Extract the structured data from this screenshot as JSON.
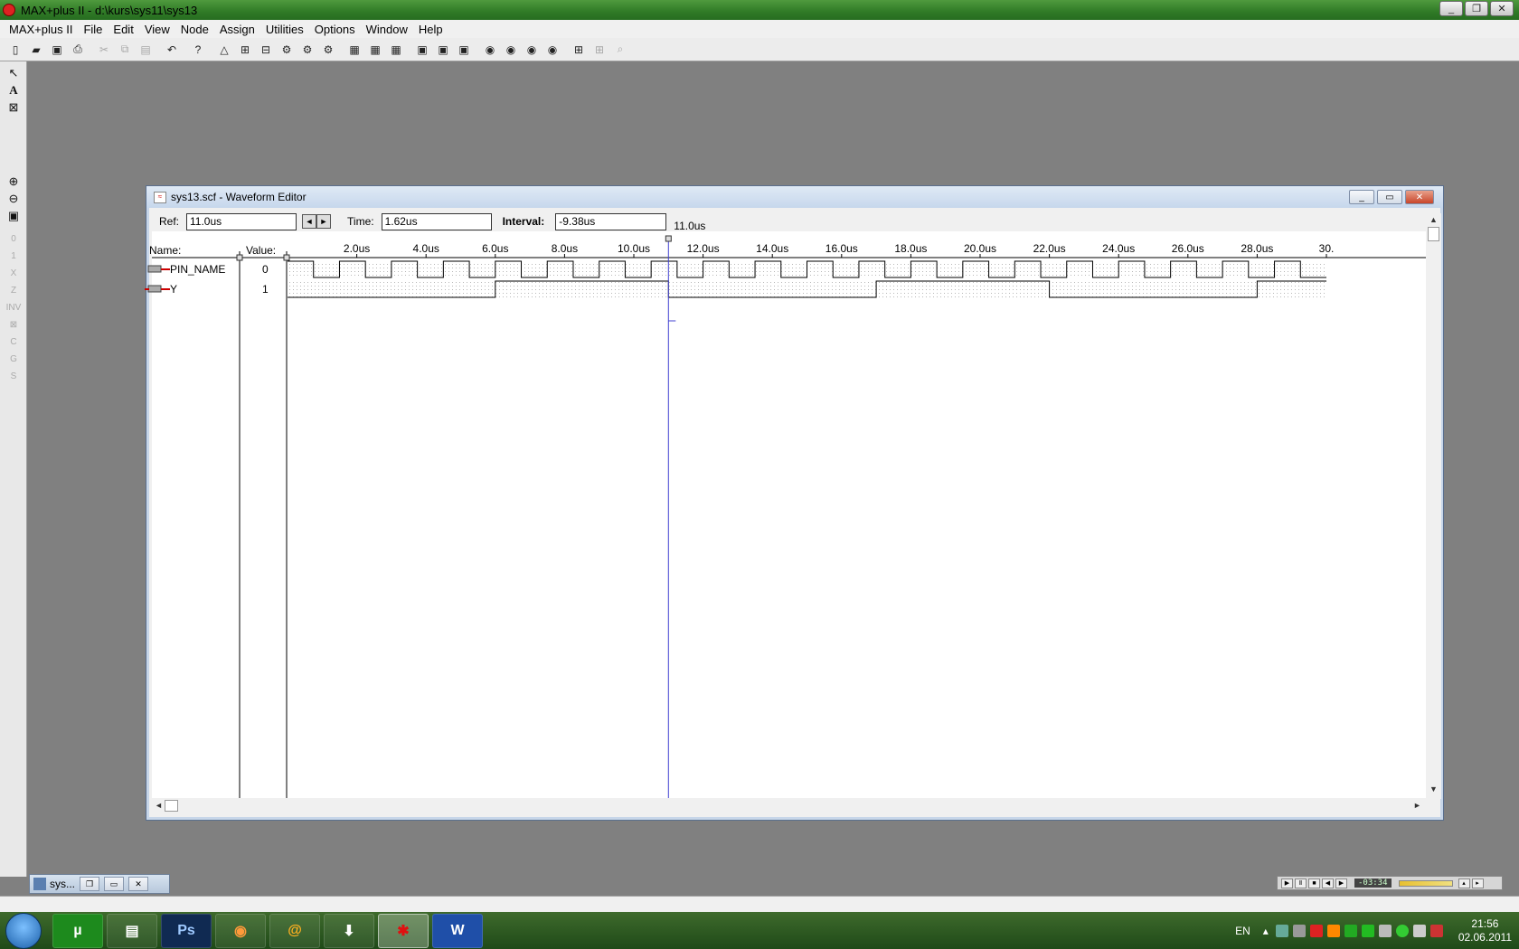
{
  "app": {
    "title": "MAX+plus II - d:\\kurs\\sys11\\sys13"
  },
  "menu": [
    "MAX+plus II",
    "File",
    "Edit",
    "View",
    "Node",
    "Assign",
    "Utilities",
    "Options",
    "Window",
    "Help"
  ],
  "waveform_window": {
    "title": "sys13.scf - Waveform Editor",
    "ref_label": "Ref:",
    "ref_value": "11.0us",
    "time_label": "Time:",
    "time_value": "1.62us",
    "interval_label": "Interval:",
    "interval_value": "-9.38us",
    "cursor_label": "11.0us",
    "cursor_time_us": 11.0,
    "name_header": "Name:",
    "value_header": "Value:",
    "time_axis": {
      "ticks": [
        "2.0us",
        "4.0us",
        "6.0us",
        "8.0us",
        "10.0us",
        "12.0us",
        "14.0us",
        "16.0us",
        "18.0us",
        "20.0us",
        "22.0us",
        "24.0us",
        "26.0us",
        "28.0us",
        "30."
      ],
      "range_us": [
        0,
        30
      ]
    },
    "signals": [
      {
        "name": "PIN_NAME",
        "value": "0",
        "type": "input",
        "waveform": "clock",
        "period_us": 1.5
      },
      {
        "name": "Y",
        "value": "1",
        "type": "output",
        "waveform": "levels",
        "transitions_us": [
          0,
          6.0,
          11.0,
          17.0,
          22.0,
          28.0
        ],
        "levels": [
          0,
          1,
          0,
          1,
          0,
          1
        ]
      }
    ]
  },
  "minimized_window": {
    "label": "sys..."
  },
  "taskbar": {
    "language": "EN",
    "time": "21:56",
    "date": "02.06.2011",
    "apps": [
      "utorrent",
      "explorer",
      "Ps",
      "firefox",
      "mail-agent",
      "downloader",
      "maxplus",
      "word"
    ]
  },
  "media_player": {
    "time": "-03:34"
  }
}
